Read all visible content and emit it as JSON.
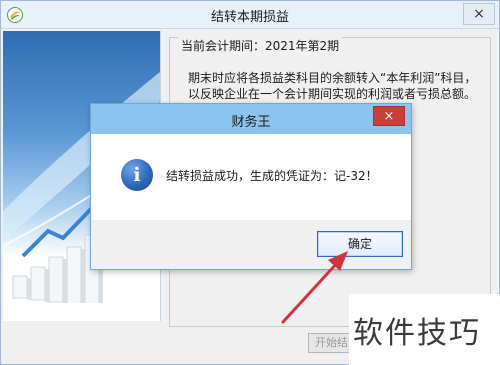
{
  "window": {
    "title": "结转本期损益",
    "close_glyph": "×"
  },
  "period": {
    "label": "当前会计期间：2021年第2期"
  },
  "description": "期末时应将各损益类科目的余额转入“本年利润”科目，以反映企业在一个会计期间实现的利润或者亏损总额。本功能将损益类科目的",
  "start_button": {
    "label": "开始结"
  },
  "dialog": {
    "title": "财务王",
    "close_glyph": "×",
    "icon_glyph": "i",
    "message": "结转损益成功，生成的凭证为：记-32！",
    "ok_label": "确定"
  },
  "watermark": {
    "text": "软件技巧"
  },
  "colors": {
    "dialog_titlebar": "#8cc4f0",
    "close_red": "#c9403a",
    "info_blue": "#2a63b8",
    "arrow_red": "#d0343b"
  }
}
